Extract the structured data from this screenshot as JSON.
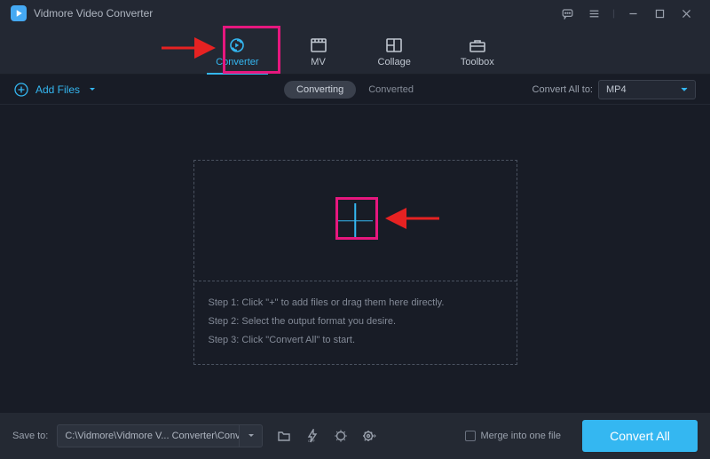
{
  "app": {
    "title": "Vidmore Video Converter"
  },
  "tabs": [
    {
      "label": "Converter"
    },
    {
      "label": "MV"
    },
    {
      "label": "Collage"
    },
    {
      "label": "Toolbox"
    }
  ],
  "toolbar": {
    "add_files_label": "Add Files",
    "segment": {
      "converting": "Converting",
      "converted": "Converted"
    },
    "convert_all_to_label": "Convert All to:",
    "selected_format": "MP4"
  },
  "drop": {
    "step1": "Step 1: Click \"+\" to add files or drag them here directly.",
    "step2": "Step 2: Select the output format you desire.",
    "step3": "Step 3: Click \"Convert All\" to start."
  },
  "bottom": {
    "save_to_label": "Save to:",
    "save_path": "C:\\Vidmore\\Vidmore V... Converter\\Converted",
    "merge_label": "Merge into one file",
    "convert_button": "Convert All"
  },
  "annotation_highlight_color": "#e6177e"
}
